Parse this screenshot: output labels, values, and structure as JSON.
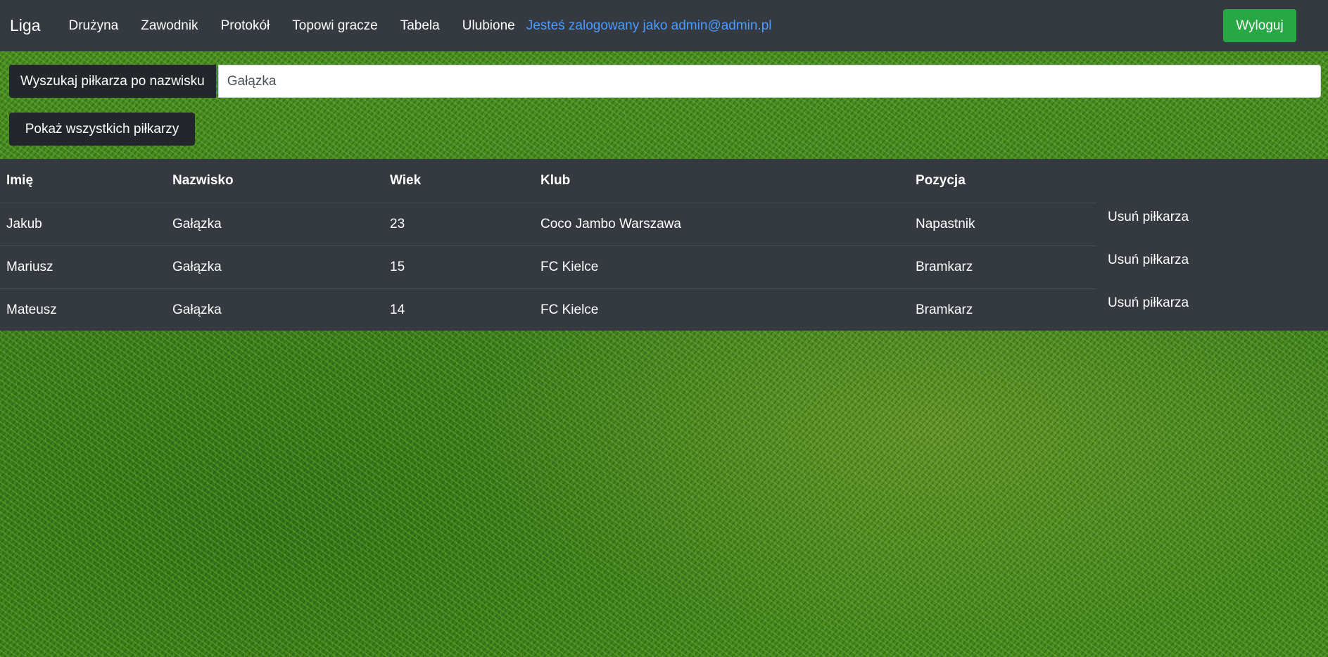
{
  "navbar": {
    "brand": "Liga",
    "links": [
      "Drużyna",
      "Zawodnik",
      "Protokół",
      "Topowi gracze",
      "Tabela",
      "Ulubione"
    ],
    "login_info": "Jesteś zalogowany jako admin@admin.pl",
    "logout_label": "Wyloguj"
  },
  "search": {
    "label": "Wyszukaj piłkarza po nazwisku",
    "value": "Gałązka"
  },
  "show_all_label": "Pokaż wszystkich piłkarzy",
  "table": {
    "headers": [
      "Imię",
      "Nazwisko",
      "Wiek",
      "Klub",
      "Pozycja"
    ],
    "rows": [
      [
        "Jakub",
        "Gałązka",
        "23",
        "Coco Jambo Warszawa",
        "Napastnik"
      ],
      [
        "Mariusz",
        "Gałązka",
        "15",
        "FC Kielce",
        "Bramkarz"
      ],
      [
        "Mateusz",
        "Gałązka",
        "14",
        "FC Kielce",
        "Bramkarz"
      ]
    ],
    "delete_label": "Usuń piłkarza"
  },
  "colors": {
    "navbar_bg": "#343a40",
    "logout_bg": "#28a745",
    "login_info": "#4c9bff"
  }
}
